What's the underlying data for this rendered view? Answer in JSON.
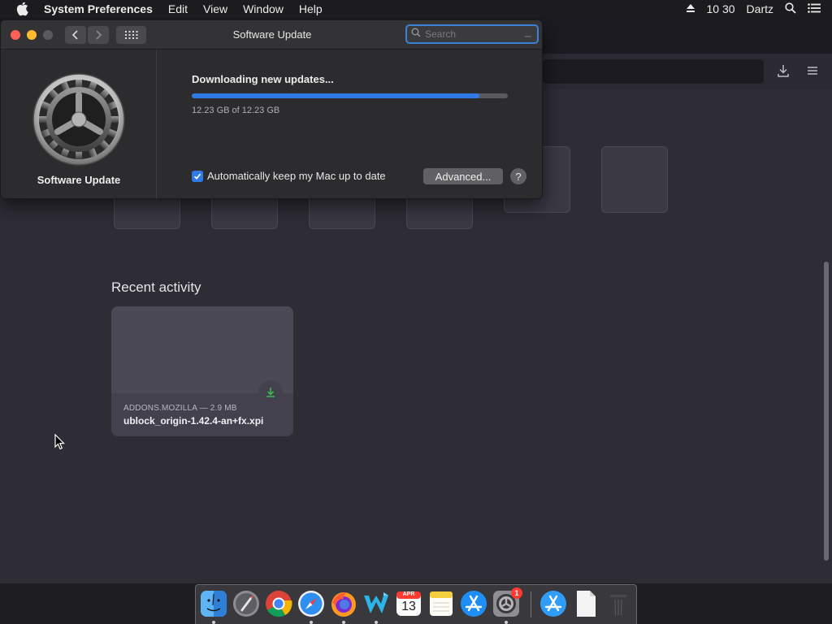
{
  "menubar": {
    "app_name": "System Preferences",
    "items": [
      "Edit",
      "View",
      "Window",
      "Help"
    ],
    "time": "10 30",
    "user": "Dartz"
  },
  "software_update": {
    "window_title": "Software Update",
    "search_placeholder": "Search",
    "sidebar_label": "Software Update",
    "status": "Downloading new updates...",
    "progress": 0.91,
    "size_text": "12.23 GB of 12.23 GB",
    "auto_update_label": "Automatically keep my Mac up to date",
    "auto_update_checked": true,
    "advanced_button": "Advanced...",
    "help_button": "?"
  },
  "browser": {
    "recent_activity_title": "Recent activity",
    "activity_card": {
      "source": "ADDONS.MOZILLA — 2.9 MB",
      "filename": "ublock_origin-1.42.4-an+fx.xpi"
    }
  },
  "dock": {
    "items": [
      "finder-icon",
      "launchpad-icon",
      "chrome-icon",
      "safari-icon",
      "firefox-icon",
      "waterfox-icon",
      "calendar-icon",
      "notes-icon",
      "app-store-icon",
      "system-preferences-icon",
      "app-store-folder-icon",
      "document-icon",
      "trash-icon"
    ],
    "calendar_month": "APR",
    "calendar_day": "13",
    "sysprefs_badge": "1"
  },
  "colors": {
    "accent": "#2f7ae5",
    "badge": "#ff3b30"
  }
}
